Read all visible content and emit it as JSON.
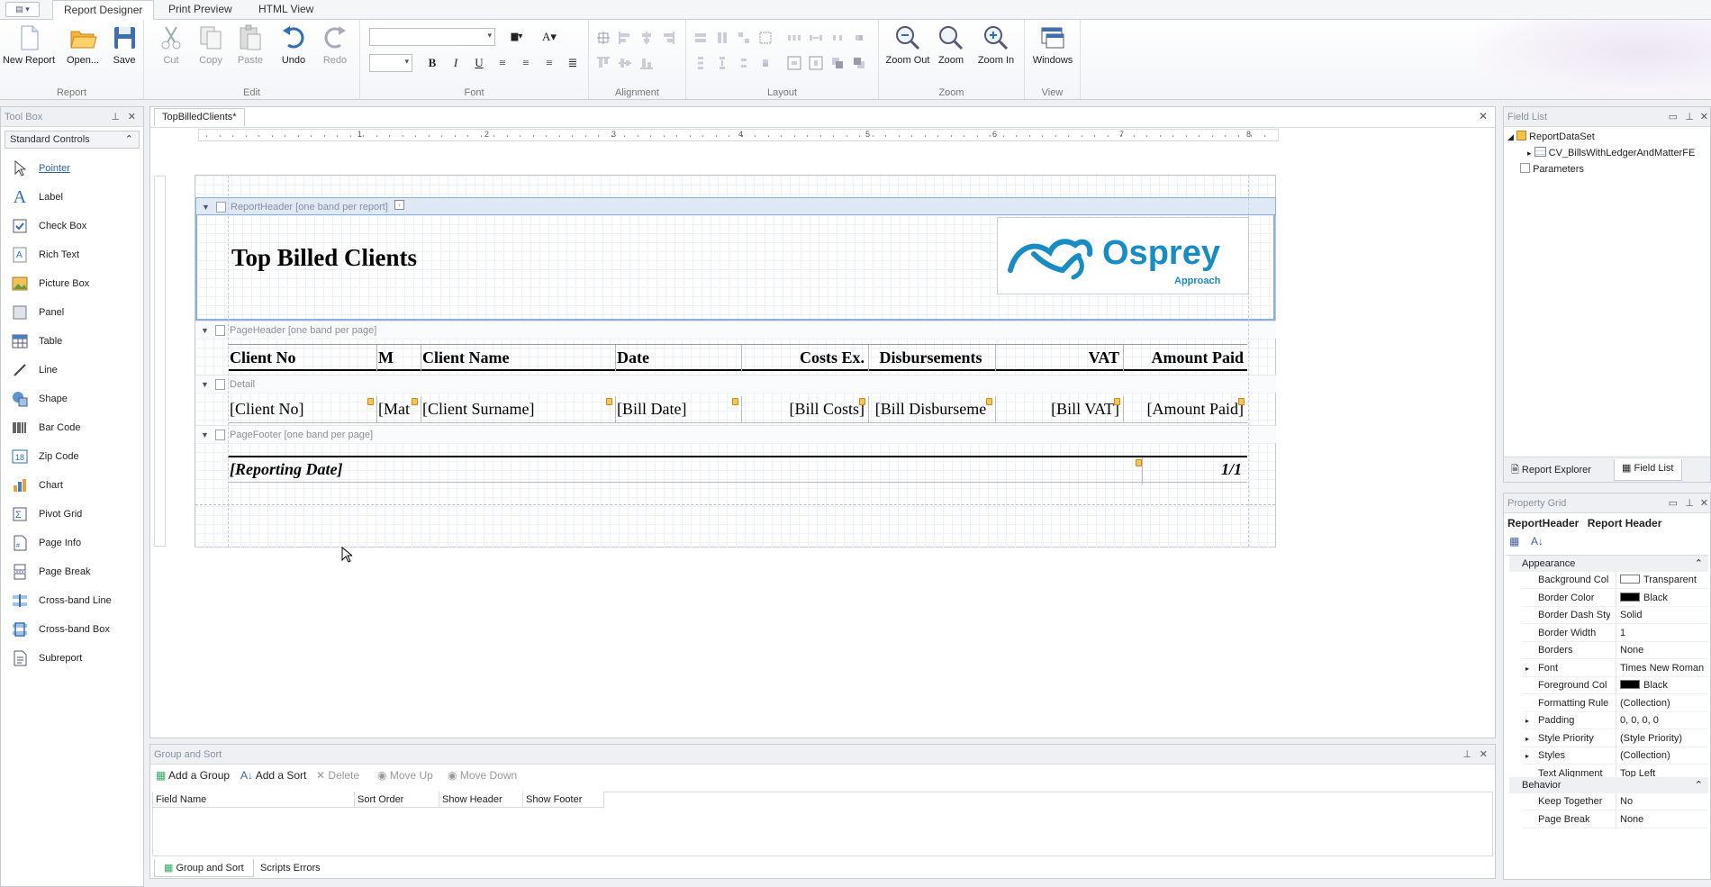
{
  "ribbon": {
    "tabs": [
      "Report Designer",
      "Print Preview",
      "HTML View"
    ],
    "groups": {
      "report": {
        "label": "Report",
        "new": "New Report",
        "open": "Open...",
        "save": "Save"
      },
      "edit": {
        "label": "Edit",
        "cut": "Cut",
        "copy": "Copy",
        "paste": "Paste",
        "undo": "Undo",
        "redo": "Redo"
      },
      "font": {
        "label": "Font",
        "bold": "B",
        "italic": "I",
        "underline": "U"
      },
      "alignment": {
        "label": "Alignment"
      },
      "layout": {
        "label": "Layout"
      },
      "zoom": {
        "label": "Zoom",
        "zoom_out": "Zoom Out",
        "zoom": "Zoom",
        "zoom_in": "Zoom In"
      },
      "view": {
        "label": "View",
        "windows": "Windows"
      }
    }
  },
  "toolbox": {
    "title": "Tool Box",
    "category": "Standard Controls",
    "items": [
      {
        "label": "Pointer",
        "icon": "pointer-icon"
      },
      {
        "label": "Label",
        "icon": "label-icon"
      },
      {
        "label": "Check Box",
        "icon": "checkbox-icon"
      },
      {
        "label": "Rich Text",
        "icon": "rich-text-icon"
      },
      {
        "label": "Picture Box",
        "icon": "picture-icon"
      },
      {
        "label": "Panel",
        "icon": "panel-icon"
      },
      {
        "label": "Table",
        "icon": "table-icon"
      },
      {
        "label": "Line",
        "icon": "line-icon"
      },
      {
        "label": "Shape",
        "icon": "shape-icon"
      },
      {
        "label": "Bar Code",
        "icon": "barcode-icon"
      },
      {
        "label": "Zip Code",
        "icon": "zipcode-icon"
      },
      {
        "label": "Chart",
        "icon": "chart-icon"
      },
      {
        "label": "Pivot Grid",
        "icon": "pivot-icon"
      },
      {
        "label": "Page Info",
        "icon": "page-info-icon"
      },
      {
        "label": "Page Break",
        "icon": "page-break-icon"
      },
      {
        "label": "Cross-band Line",
        "icon": "crossband-line-icon"
      },
      {
        "label": "Cross-band Box",
        "icon": "crossband-box-icon"
      },
      {
        "label": "Subreport",
        "icon": "subreport-icon"
      }
    ]
  },
  "designer": {
    "doc_tab": "TopBilledClients*",
    "ruler_numbers": [
      "1",
      "2",
      "3",
      "4",
      "5",
      "6",
      "7",
      "8"
    ],
    "bands": {
      "report_header": "ReportHeader [one band per report]",
      "page_header": "PageHeader [one band per page]",
      "detail": "Detail",
      "page_footer": "PageFooter [one band per page]"
    },
    "report_title": "Top Billed Clients",
    "logo": {
      "text": "Osprey",
      "sub": "Approach",
      "color": "#1a8cc4"
    },
    "header_cells": [
      "Client No",
      "M",
      "Client Name",
      "Date",
      "Costs Ex.",
      "Disbursements",
      "VAT",
      "Amount Paid"
    ],
    "detail_cells": [
      "[Client No]",
      "[Mat",
      "[Client Surname]",
      "[Bill Date]",
      "[Bill Costs]",
      "[Bill Disburseme",
      "[Bill VAT]",
      "[Amount Paid]"
    ],
    "footer_date": "[Reporting Date]",
    "footer_page": "1/1"
  },
  "group_sort": {
    "title": "Group and Sort",
    "buttons": {
      "add_group": "Add a Group",
      "add_sort": "Add a Sort",
      "delete": "Delete",
      "move_up": "Move Up",
      "move_down": "Move Down"
    },
    "columns": [
      "Field Name",
      "Sort Order",
      "Show Header",
      "Show Footer"
    ],
    "bottom_tabs": [
      "Group and Sort",
      "Scripts Errors"
    ]
  },
  "field_list": {
    "title": "Field List",
    "root": "ReportDataSet",
    "child": "CV_BillsWithLedgerAndMatterFE",
    "parameters": "Parameters",
    "tabs": [
      "Report Explorer",
      "Field List"
    ]
  },
  "property_grid": {
    "title": "Property Grid",
    "selected_name": "ReportHeader",
    "selected_type": "Report Header",
    "categories": {
      "appearance": "Appearance",
      "behavior": "Behavior"
    },
    "rows": [
      {
        "key": "Background Col",
        "value": "Transparent",
        "swatch": "#ffffff"
      },
      {
        "key": "Border Color",
        "value": "Black",
        "swatch": "#000000"
      },
      {
        "key": "Border Dash Sty",
        "value": "Solid"
      },
      {
        "key": "Border Width",
        "value": "1"
      },
      {
        "key": "Borders",
        "value": "None"
      },
      {
        "key": "Font",
        "value": "Times New Roman,..."
      },
      {
        "key": "Foreground Col",
        "value": "Black",
        "swatch": "#000000"
      },
      {
        "key": "Formatting Rule",
        "value": "(Collection)"
      },
      {
        "key": "Padding",
        "value": "0, 0, 0, 0"
      },
      {
        "key": "Style Priority",
        "value": "(Style Priority)"
      },
      {
        "key": "Styles",
        "value": "(Collection)"
      },
      {
        "key": "Text Alignment",
        "value": "Top Left"
      }
    ],
    "behavior_rows": [
      {
        "key": "Keep Together",
        "value": "No"
      },
      {
        "key": "Page Break",
        "value": "None"
      }
    ]
  }
}
